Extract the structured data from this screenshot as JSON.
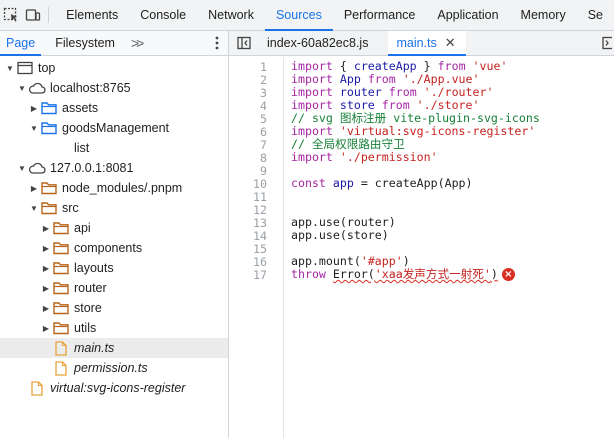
{
  "toolbar": {
    "tabs": [
      "Elements",
      "Console",
      "Network",
      "Sources",
      "Performance",
      "Application",
      "Memory",
      "Se"
    ],
    "active_tab": "Sources"
  },
  "navigator": {
    "tabs": [
      "Page",
      "Filesystem"
    ],
    "more_label": ">>",
    "tree": [
      {
        "label": "top",
        "icon": "frame-icon",
        "arrow": "open",
        "level": 0
      },
      {
        "label": "localhost:8765",
        "icon": "cloud-icon",
        "arrow": "open",
        "level": 1
      },
      {
        "label": "assets",
        "icon": "folder-blue-icon",
        "arrow": "closed",
        "level": 2
      },
      {
        "label": "goodsManagement",
        "icon": "folder-blue-icon",
        "arrow": "open",
        "level": 2
      },
      {
        "label": "list",
        "icon": "none",
        "arrow": "none",
        "level": 3
      },
      {
        "label": "127.0.0.1:8081",
        "icon": "cloud-icon",
        "arrow": "open",
        "level": 1
      },
      {
        "label": "node_modules/.pnpm",
        "icon": "folder-orange-icon",
        "arrow": "closed",
        "level": 2
      },
      {
        "label": "src",
        "icon": "folder-orange-icon",
        "arrow": "open",
        "level": 2
      },
      {
        "label": "api",
        "icon": "folder-orange-icon",
        "arrow": "closed",
        "level": 3
      },
      {
        "label": "components",
        "icon": "folder-orange-icon",
        "arrow": "closed",
        "level": 3
      },
      {
        "label": "layouts",
        "icon": "folder-orange-icon",
        "arrow": "closed",
        "level": 3
      },
      {
        "label": "router",
        "icon": "folder-orange-icon",
        "arrow": "closed",
        "level": 3
      },
      {
        "label": "store",
        "icon": "folder-orange-icon",
        "arrow": "closed",
        "level": 3
      },
      {
        "label": "utils",
        "icon": "folder-orange-icon",
        "arrow": "closed",
        "level": 3
      },
      {
        "label": "main.ts",
        "icon": "file-orange-icon",
        "arrow": "none",
        "level": 3,
        "italic": true,
        "selected": true
      },
      {
        "label": "permission.ts",
        "icon": "file-orange-icon",
        "arrow": "none",
        "level": 3,
        "italic": true
      },
      {
        "label": "virtual:svg-icons-register",
        "icon": "file-orange-icon",
        "arrow": "none",
        "level": 1,
        "italic": true
      }
    ]
  },
  "editor": {
    "file_tabs": [
      {
        "label": "index-60a82ec8.js",
        "active": false
      },
      {
        "label": "main.ts",
        "active": true
      }
    ],
    "lines": [
      {
        "n": "1",
        "parts": [
          [
            "kw",
            "import"
          ],
          [
            "fn",
            " { "
          ],
          [
            "var",
            "createApp"
          ],
          [
            "fn",
            " } "
          ],
          [
            "kw",
            "from"
          ],
          [
            "fn",
            " "
          ],
          [
            "str",
            "'vue'"
          ]
        ]
      },
      {
        "n": "2",
        "parts": [
          [
            "kw",
            "import"
          ],
          [
            "fn",
            " "
          ],
          [
            "var",
            "App"
          ],
          [
            "fn",
            " "
          ],
          [
            "kw",
            "from"
          ],
          [
            "fn",
            " "
          ],
          [
            "str",
            "'./App.vue'"
          ]
        ]
      },
      {
        "n": "3",
        "parts": [
          [
            "kw",
            "import"
          ],
          [
            "fn",
            " "
          ],
          [
            "var",
            "router"
          ],
          [
            "fn",
            " "
          ],
          [
            "kw",
            "from"
          ],
          [
            "fn",
            " "
          ],
          [
            "str",
            "'./router'"
          ]
        ]
      },
      {
        "n": "4",
        "parts": [
          [
            "kw",
            "import"
          ],
          [
            "fn",
            " "
          ],
          [
            "var",
            "store"
          ],
          [
            "fn",
            " "
          ],
          [
            "kw",
            "from"
          ],
          [
            "fn",
            " "
          ],
          [
            "str",
            "'./store'"
          ]
        ]
      },
      {
        "n": "5",
        "parts": [
          [
            "cm",
            "// svg 图标注册 vite-plugin-svg-icons"
          ]
        ]
      },
      {
        "n": "6",
        "parts": [
          [
            "kw",
            "import"
          ],
          [
            "fn",
            " "
          ],
          [
            "str",
            "'virtual:svg-icons-register'"
          ]
        ]
      },
      {
        "n": "7",
        "parts": [
          [
            "cm",
            "// 全局权限路由守卫"
          ]
        ]
      },
      {
        "n": "8",
        "parts": [
          [
            "kw",
            "import"
          ],
          [
            "fn",
            " "
          ],
          [
            "str",
            "'./permission'"
          ]
        ]
      },
      {
        "n": "9",
        "parts": []
      },
      {
        "n": "10",
        "parts": [
          [
            "kw",
            "const"
          ],
          [
            "fn",
            " "
          ],
          [
            "var",
            "app"
          ],
          [
            "fn",
            " = createApp(App)"
          ]
        ]
      },
      {
        "n": "11",
        "parts": []
      },
      {
        "n": "12",
        "parts": []
      },
      {
        "n": "13",
        "parts": [
          [
            "fn",
            "app.use(router)"
          ]
        ]
      },
      {
        "n": "14",
        "parts": [
          [
            "fn",
            "app.use(store)"
          ]
        ]
      },
      {
        "n": "15",
        "parts": []
      },
      {
        "n": "16",
        "parts": [
          [
            "fn",
            "app.mount("
          ],
          [
            "str",
            "'#app'"
          ],
          [
            "fn",
            ")"
          ]
        ]
      },
      {
        "n": "17",
        "parts": [
          [
            "kw",
            "throw"
          ],
          [
            "fn",
            " "
          ],
          [
            "errfn",
            "Error("
          ],
          [
            "errstr",
            "'xaa发声方式一射死'"
          ],
          [
            "errfn",
            ")"
          ]
        ],
        "error": true
      }
    ],
    "error_badge": "×"
  }
}
